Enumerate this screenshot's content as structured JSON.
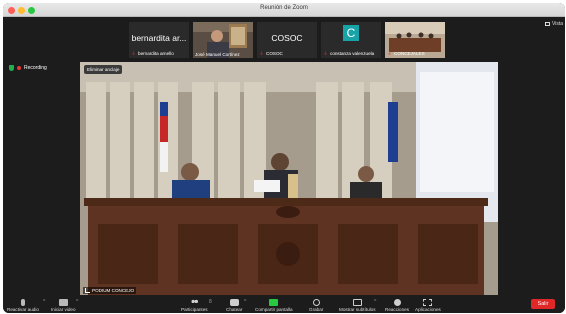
{
  "window": {
    "title": "Reunión de Zoom"
  },
  "view_button": {
    "label": "Vista"
  },
  "recording": {
    "label": "Recording"
  },
  "participants_strip": [
    {
      "display": "bernardita ar...",
      "caption": "bernardita arnello",
      "muted": true
    },
    {
      "display": "",
      "caption": "José Manuel Cortínez",
      "muted": false
    },
    {
      "display": "COSOC",
      "caption": "COSOC",
      "muted": true
    },
    {
      "display": "C",
      "caption": "constanza valenzuela",
      "muted": true
    },
    {
      "display": "",
      "caption": "CONCEJALES",
      "muted": true
    }
  ],
  "main_video": {
    "unpin_label": "Eliminar anclaje",
    "speaker_label": "PODIUM CONCEJO"
  },
  "controls": {
    "audio": "Reactivar audio",
    "video": "Iniciar video",
    "participants": "Participantes",
    "participants_count": "8",
    "chat": "Chatear",
    "share": "Compartir pantalla",
    "record": "Grabar",
    "captions": "Mostrar subtítulos",
    "reactions": "Reacciones",
    "apps": "Aplicaciones",
    "leave": "Salir"
  },
  "colors": {
    "leave": "#e02828",
    "share": "#28c840",
    "recording_dot": "#e53935",
    "avatar_c": "#18a3a9"
  }
}
